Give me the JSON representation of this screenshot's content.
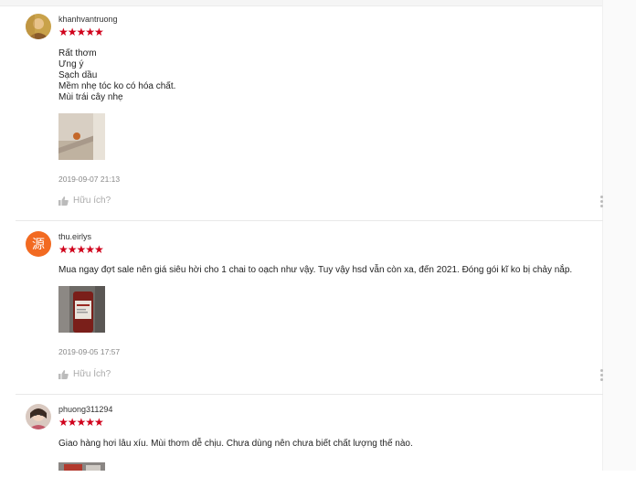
{
  "reviews": [
    {
      "author": "khanhvantruong",
      "stars": "★★★★★",
      "comment": "Rất thơm\nƯng ý\nSạch dầu\nMềm nhẹ tóc ko có hóa chất.\nMùi trái cây nhẹ",
      "time": "2019-09-07 21:13",
      "helpful": "Hữu ích?"
    },
    {
      "author": "thu.eirlys",
      "stars": "★★★★★",
      "avatar_glyph": "源",
      "comment": "Mua ngay đợt sale nên giá siêu hời cho 1 chai to oạch như vậy. Tuy vậy hsd vẫn còn xa, đến 2021. Đóng gói kĩ ko bị chảy nắp.",
      "time": "2019-09-05 17:57",
      "helpful": "Hữu Ích?"
    },
    {
      "author": "phuong311294",
      "stars": "★★★★★",
      "comment": "Giao hàng hơi lâu xíu. Mùi thơm dễ chịu. Chưa dùng nên chưa biết chất lượng thế nào."
    }
  ],
  "colors": {
    "star": "#d0011b",
    "muted": "#888888",
    "divider": "#e8e8e8"
  }
}
